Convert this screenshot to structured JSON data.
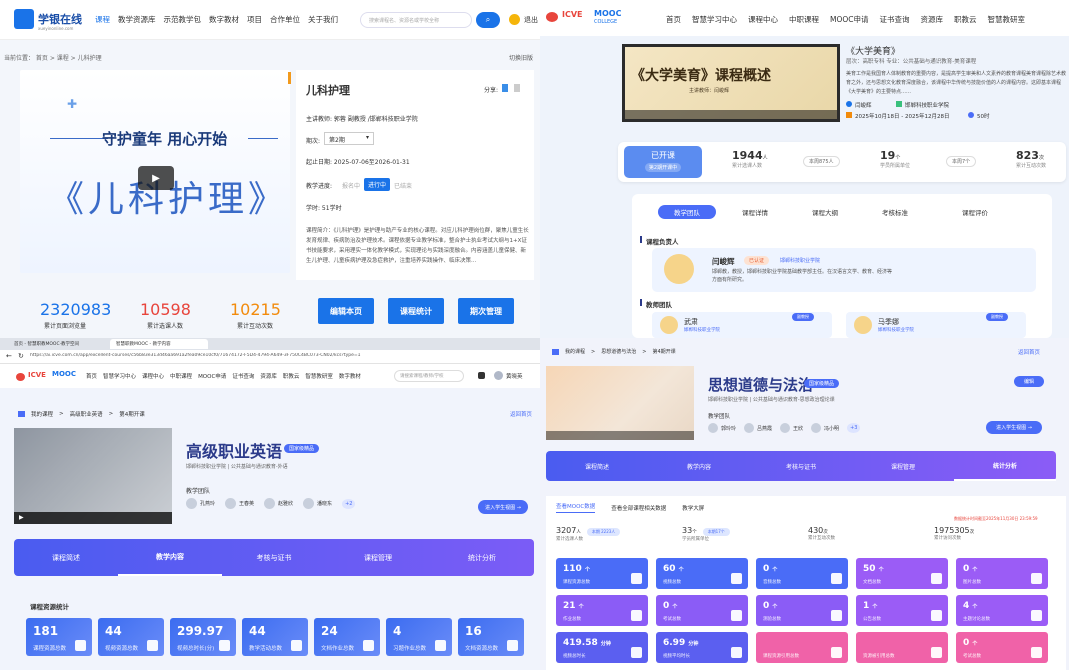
{
  "q1": {
    "logo": {
      "name": "学银在线",
      "sub": "xueyinonline.com"
    },
    "nav": [
      "课程",
      "教学资源库",
      "示范教学包",
      "数字教材",
      "项目",
      "合作单位",
      "关于我们"
    ],
    "search_placeholder": "搜索课程名、资源名或学校全称",
    "logout": "退出",
    "breadcrumb": "当前位置： 首页 > 课程 > 儿科护理",
    "switch_old": "切换旧版",
    "video": {
      "slogan": "守护童年  用心开始",
      "title": "《儿科护理》"
    },
    "course": {
      "title": "儿科护理",
      "share": "分享:",
      "teacher": "主讲教师:  郭蓉 副教授 /邯郸科技职业学院",
      "term_label": "期次:",
      "term_value": "第2期",
      "dates": "起止日期:  2025-07-06至2026-01-31",
      "status_label": "教学进度:",
      "status": [
        "报名中",
        "进行中",
        "已结束"
      ],
      "hours": "学时:  51学时",
      "intro": "课程简介：《儿科护理》是护理与助产专业的核心课程。对应儿科护理岗位群，聚焦儿童生长发育规律、疾病防治及护理技术。课程依据专业教学标准，整合护士执业考试大纲与1+X证书技能要求，采用理实一体化教学模式，实现理论与实践深度融合。内容涵盖儿童保健、新生儿护理、儿童疾病护理及急症救护，注重培养实践操作、临床决策..."
    },
    "stats": [
      {
        "value": "2320983",
        "label": "累计页面浏览量",
        "color": "#1a73e8"
      },
      {
        "value": "10598",
        "label": "累计选课人数",
        "color": "#e8453c"
      },
      {
        "value": "10215",
        "label": "累计互动次数",
        "color": "#f28b0c"
      }
    ],
    "buttons": [
      "编辑本页",
      "课程统计",
      "期次管理"
    ]
  },
  "q2": {
    "logo": {
      "icve": "ICVE",
      "mooc": "MOOC",
      "college": "COLLEGE"
    },
    "nav": [
      "首页",
      "智慧学习中心",
      "课程中心",
      "中职课程",
      "MOOC申请",
      "证书查询",
      "资源库",
      "职教云",
      "智慧教研室"
    ],
    "video": {
      "title": "《大学美育》课程概述",
      "lecturer": "主讲教师：闫峻辉"
    },
    "course": {
      "title": "《大学美育》",
      "meta": "层次：高职专科    专业：公共基础与通识教育-美育课程",
      "intro": "美育工作是我国育人体制教育的重要内容，是提高学生审美和人文素养的教育课程美育课程除艺术教育之外，还与思想文化教育深度融合，该课程中华传统与技能价值的人的课程内容。这即基本课程《大学美育》的主要特点……",
      "teacher": "闫峻辉",
      "school": "邯郸科技职业学院",
      "dates": "2025年10月18日 - 2025年12月28日",
      "hours": "50时"
    },
    "stats": {
      "status": "已开课",
      "status_sub": "第2期开课中",
      "learners": "1944",
      "learners_unit": "人",
      "learners_label": "累计选课人数",
      "weekly_learners": "本周875人",
      "units": "19",
      "units_unit": "个",
      "units_label": "学员所属单位",
      "weekly_units": "本周7个",
      "interactions": "823",
      "interactions_unit": "次",
      "interactions_label": "累计互动次数"
    },
    "tabs": [
      "教学团队",
      "课程详情",
      "课程大纲",
      "考核标准",
      "课程评价"
    ],
    "head_title": "课程负责人",
    "leader": {
      "name": "闫峻辉",
      "badge": "已认证",
      "school": "邯郸科技职业学院",
      "desc": "邯郸教，教授，邯郸科技职业学院基础教学部主任。在汉语言文学、教育、经济等方面有所研究。"
    },
    "team_title": "教师团队",
    "team": [
      {
        "name": "武肃",
        "school": "邯郸科技职业学院",
        "badge": "副教授"
      },
      {
        "name": "马季娜",
        "school": "邯郸科技职业学院",
        "badge": "副教授"
      }
    ]
  },
  "q3": {
    "browser": {
      "tab1": "首页 - 智慧职教MOOC·教学空间",
      "tab2": "智慧职教MOOC - 教学内容",
      "url": "https://ai.icve.com.cn/app/excellent-courses/c56b83e313d46aa691a2fea09ce10cf0/71674172-F5D4-4794-A649-3F750C4BC073-CN02/kcs?type=1"
    },
    "nav": [
      "首页",
      "智慧学习中心",
      "课程中心",
      "中职课程",
      "MOOC申请",
      "证书查询",
      "资源库",
      "职教云",
      "智慧教研室",
      "数字教材"
    ],
    "search_placeholder": "请搜索课程/教师/学校",
    "user": "黄晓英",
    "crumbs": [
      "我的课程",
      "高级职业英语",
      "第4期开课"
    ],
    "back": "返回首页",
    "course": {
      "title": "高级职业英语",
      "tag": "国家级精品",
      "meta": "邯郸科技职业学院  |  公共基础与通识教育-外语",
      "team_label": "教学团队",
      "team": [
        "孔燕玲",
        "王春英",
        "赵雅欣",
        "潘晓东"
      ],
      "more": "+2"
    },
    "cta": "进入学生视图 →",
    "tabs": [
      "课程简述",
      "教学内容",
      "考核与证书",
      "课程管理",
      "统计分析"
    ],
    "resources_title": "课程资源统计",
    "cards": [
      {
        "value": "181",
        "label": "课程资源总数"
      },
      {
        "value": "44",
        "label": "视频资源总数"
      },
      {
        "value": "299.97",
        "label": "视频总时长(分)"
      },
      {
        "value": "44",
        "label": "教学活动总数"
      },
      {
        "value": "24",
        "label": "文档作业总数"
      },
      {
        "value": "4",
        "label": "习题作业总数"
      },
      {
        "value": "16",
        "label": "文档资源总数"
      }
    ]
  },
  "q4": {
    "crumbs": [
      "我的课程",
      "思想道德与法治",
      "第4期开课"
    ],
    "back": "返回首页",
    "course": {
      "title": "思想道德与法治",
      "tag": "国家级精品",
      "meta": "邯郸科技职业学院  |  公共基础与通识教育-思想政治理论课",
      "team_label": "教学团队",
      "team": [
        "郭玲玲",
        "吕燕霞",
        "王欣",
        "冯小明"
      ],
      "more": "+3"
    },
    "edit": "编辑",
    "cta": "进入学生视图 →",
    "tabs": [
      "课程简述",
      "教学内容",
      "考核与证书",
      "课程管理",
      "统计分析"
    ],
    "subtabs": [
      "查看MOOC数据",
      "查看全部课程相关数据",
      "教学大屏"
    ],
    "updated": "数据统计时间截至2025年11月30日 23:59:59",
    "big": [
      {
        "value": "3207",
        "unit": "人",
        "label": "累计选课人数",
        "tag": "本期 2223人"
      },
      {
        "value": "33",
        "unit": "个",
        "label": "学员所属单位",
        "tag": "本期17个"
      },
      {
        "value": "430",
        "unit": "次",
        "label": "累计互动次数",
        "tag": ""
      },
      {
        "value": "1975305",
        "unit": "次",
        "label": "累计访问次数",
        "tag": ""
      }
    ],
    "cards": [
      {
        "value": "110",
        "unit": "个",
        "label": "课程资源总数",
        "c": "#4a6cf7"
      },
      {
        "value": "60",
        "unit": "个",
        "label": "视频总数",
        "c": "#4a6cf7"
      },
      {
        "value": "0",
        "unit": "个",
        "label": "音频总数",
        "c": "#4a6cf7"
      },
      {
        "value": "50",
        "unit": "个",
        "label": "文档总数",
        "c": "#9b5cf6"
      },
      {
        "value": "0",
        "unit": "个",
        "label": "图片总数",
        "c": "#9b5cf6"
      },
      {
        "value": "21",
        "unit": "个",
        "label": "作业总数",
        "c": "#8b5cf6"
      },
      {
        "value": "0",
        "unit": "个",
        "label": "考试总数",
        "c": "#8b5cf6"
      },
      {
        "value": "0",
        "unit": "个",
        "label": "测验总数",
        "c": "#8b5cf6"
      },
      {
        "value": "1",
        "unit": "个",
        "label": "公告总数",
        "c": "#9b5cf6"
      },
      {
        "value": "4",
        "unit": "个",
        "label": "主题讨论总数",
        "c": "#9b5cf6"
      },
      {
        "value": "419.58",
        "unit": "分钟",
        "label": "视频总时长",
        "c": "#5b5ff0"
      },
      {
        "value": "6.99",
        "unit": "分钟",
        "label": "视频平均时长",
        "c": "#5b5ff0"
      },
      {
        "value": "",
        "unit": "",
        "label": "课程资源引用总数",
        "c": "#f062a8"
      },
      {
        "value": "",
        "unit": "",
        "label": "资源被引用总数",
        "c": "#f062a8"
      },
      {
        "value": "0",
        "unit": "个",
        "label": "考试总数",
        "c": "#f062a8"
      }
    ]
  }
}
